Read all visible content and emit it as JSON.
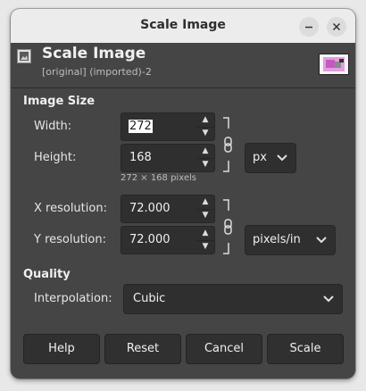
{
  "window": {
    "title": "Scale Image"
  },
  "header": {
    "title": "Scale Image",
    "subtitle": "[original] (imported)-2"
  },
  "image_size": {
    "heading": "Image Size",
    "width_label": "Width:",
    "width_value": "272",
    "height_label": "Height:",
    "height_value": "168",
    "size_unit": "px",
    "pixels_info": "272 × 168 pixels",
    "xres_label": "X resolution:",
    "xres_value": "72.000",
    "yres_label": "Y resolution:",
    "yres_value": "72.000",
    "res_unit": "pixels/in"
  },
  "quality": {
    "heading": "Quality",
    "interp_label": "Interpolation:",
    "interp_value": "Cubic"
  },
  "buttons": {
    "help": "Help",
    "reset": "Reset",
    "cancel": "Cancel",
    "scale": "Scale"
  },
  "colors": {
    "dialog_bg": "#454545",
    "field_bg": "#2f2f2f",
    "titlebar_bg": "#ececec"
  }
}
